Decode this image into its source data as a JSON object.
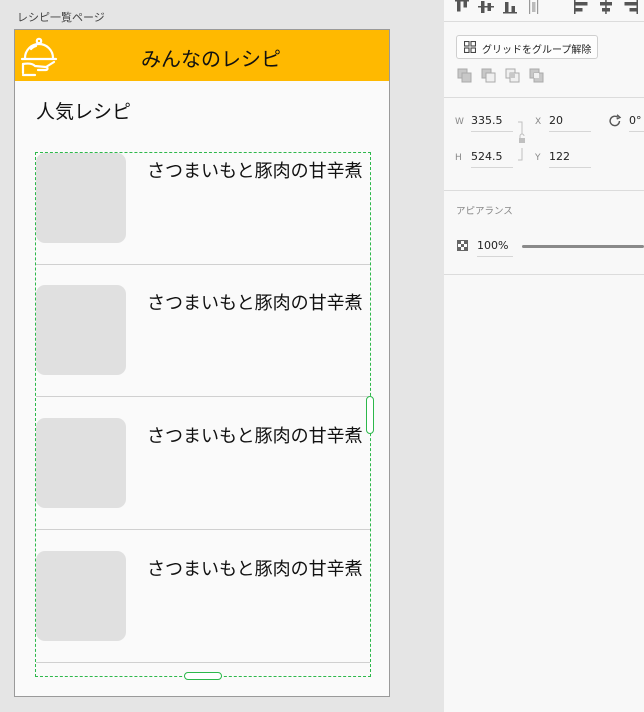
{
  "artboard": {
    "label": "レシピ一覧ページ"
  },
  "app": {
    "title": "みんなのレシピ",
    "header_color": "#ffb900",
    "section_heading": "人気レシピ"
  },
  "recipes": [
    {
      "title": "さつまいもと豚肉の甘辛煮"
    },
    {
      "title": "さつまいもと豚肉の甘辛煮"
    },
    {
      "title": "さつまいもと豚肉の甘辛煮"
    },
    {
      "title": "さつまいもと豚肉の甘辛煮"
    }
  ],
  "selection_color": "#2db84b",
  "inspector": {
    "ungroup_label": "グリッドをグループ解除",
    "transform": {
      "w_label": "W",
      "w": "335.5",
      "h_label": "H",
      "h": "524.5",
      "x_label": "X",
      "x": "20",
      "y_label": "Y",
      "y": "122",
      "rotation": "0°"
    },
    "appearance": {
      "heading": "アピアランス",
      "opacity": "100%"
    }
  }
}
